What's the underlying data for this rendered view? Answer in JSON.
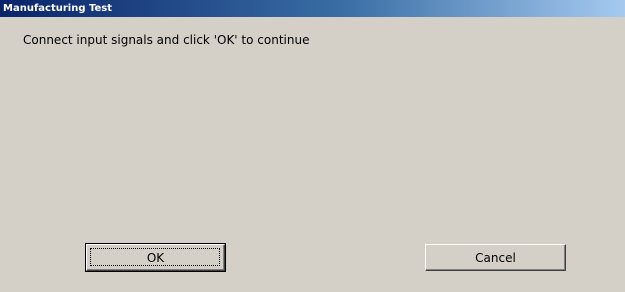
{
  "window": {
    "title": "Manufacturing Test"
  },
  "dialog": {
    "message": "Connect input signals and click 'OK' to continue"
  },
  "buttons": {
    "ok_label": "OK",
    "cancel_label": "Cancel"
  },
  "colors": {
    "titlebar_start": "#0a246a",
    "titlebar_end": "#a6caf0",
    "dialog_background": "#d4d0c8",
    "title_text": "#ffffff"
  }
}
